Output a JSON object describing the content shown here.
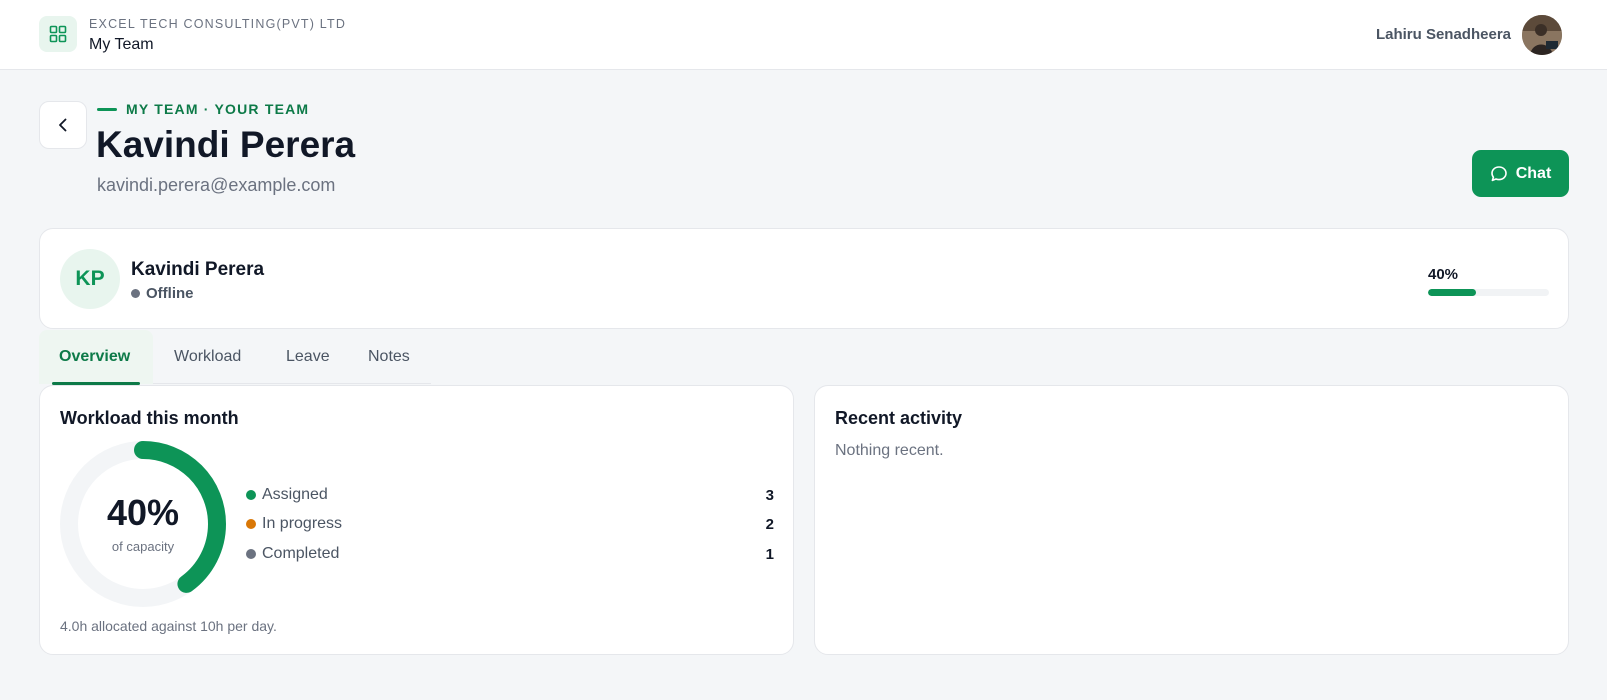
{
  "header": {
    "org_name": "EXCEL TECH CONSULTING(PVT) LTD",
    "app_title": "My Team",
    "user_name": "Lahiru Senadheera",
    "app_icon": "grid-icon",
    "avatar": "user-avatar-photo"
  },
  "page": {
    "eyebrow": "MY TEAM · YOUR TEAM",
    "title": "Kavindi Perera",
    "email": "kavindi.perera@example.com",
    "chat_label": "Chat",
    "back_icon": "chevron-left-icon",
    "chat_icon": "chat-bubble-icon"
  },
  "profile": {
    "initials": "KP",
    "name": "Kavindi Perera",
    "status": "Offline",
    "capacity_label": "40%",
    "capacity_fraction": 0.4
  },
  "tabs": [
    {
      "label": "Overview",
      "active": true
    },
    {
      "label": "Workload",
      "active": false
    },
    {
      "label": "Leave",
      "active": false
    },
    {
      "label": "Notes",
      "active": false
    }
  ],
  "workload": {
    "title": "Workload this month",
    "percent_label": "40%",
    "percent_fraction": 0.4,
    "sub_label": "of capacity",
    "legend": [
      {
        "label": "Assigned",
        "count": "3",
        "color": "#0d9457"
      },
      {
        "label": "In progress",
        "count": "2",
        "color": "#d97706"
      },
      {
        "label": "Completed",
        "count": "1",
        "color": "#6b7280"
      }
    ],
    "footnote": "4.0h allocated against 10h per day."
  },
  "activity": {
    "title": "Recent activity",
    "empty_text": "Nothing recent."
  },
  "colors": {
    "brand": "#0d9457",
    "brand_dark": "#0d7a48",
    "background": "#f4f6f8"
  }
}
